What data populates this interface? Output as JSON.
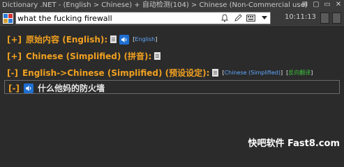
{
  "window": {
    "title": "Dictionary .NET - (English > Chinese) + 自动检测(104) > Chinese (Non-Commercial use)",
    "controls": [
      "⊞",
      "▢",
      "▭",
      "✕"
    ]
  },
  "toolbar": {
    "search_value": "what the fucking firewall",
    "clock": "10:11:13"
  },
  "entries": [
    {
      "toggle": "[+]",
      "label": "原始内容 (English):",
      "link": "English"
    },
    {
      "toggle": "[+]",
      "label": "Chinese (Simplified) (拼音):"
    },
    {
      "toggle": "[-]",
      "label": "English->Chinese (Simplified) (预设设定):",
      "link1": "Chinese (Simplified)",
      "link2": "反向翻译"
    }
  ],
  "result": {
    "toggle": "[-]",
    "text": "什么他妈的防火墙"
  },
  "watermark": {
    "text": "快吧软件 Fast8.com"
  },
  "colors": {
    "accent_orange": "#f0a020",
    "link_blue": "#5fa8ff",
    "link_green": "#3fbf3f",
    "background": "#2b2b2b"
  }
}
